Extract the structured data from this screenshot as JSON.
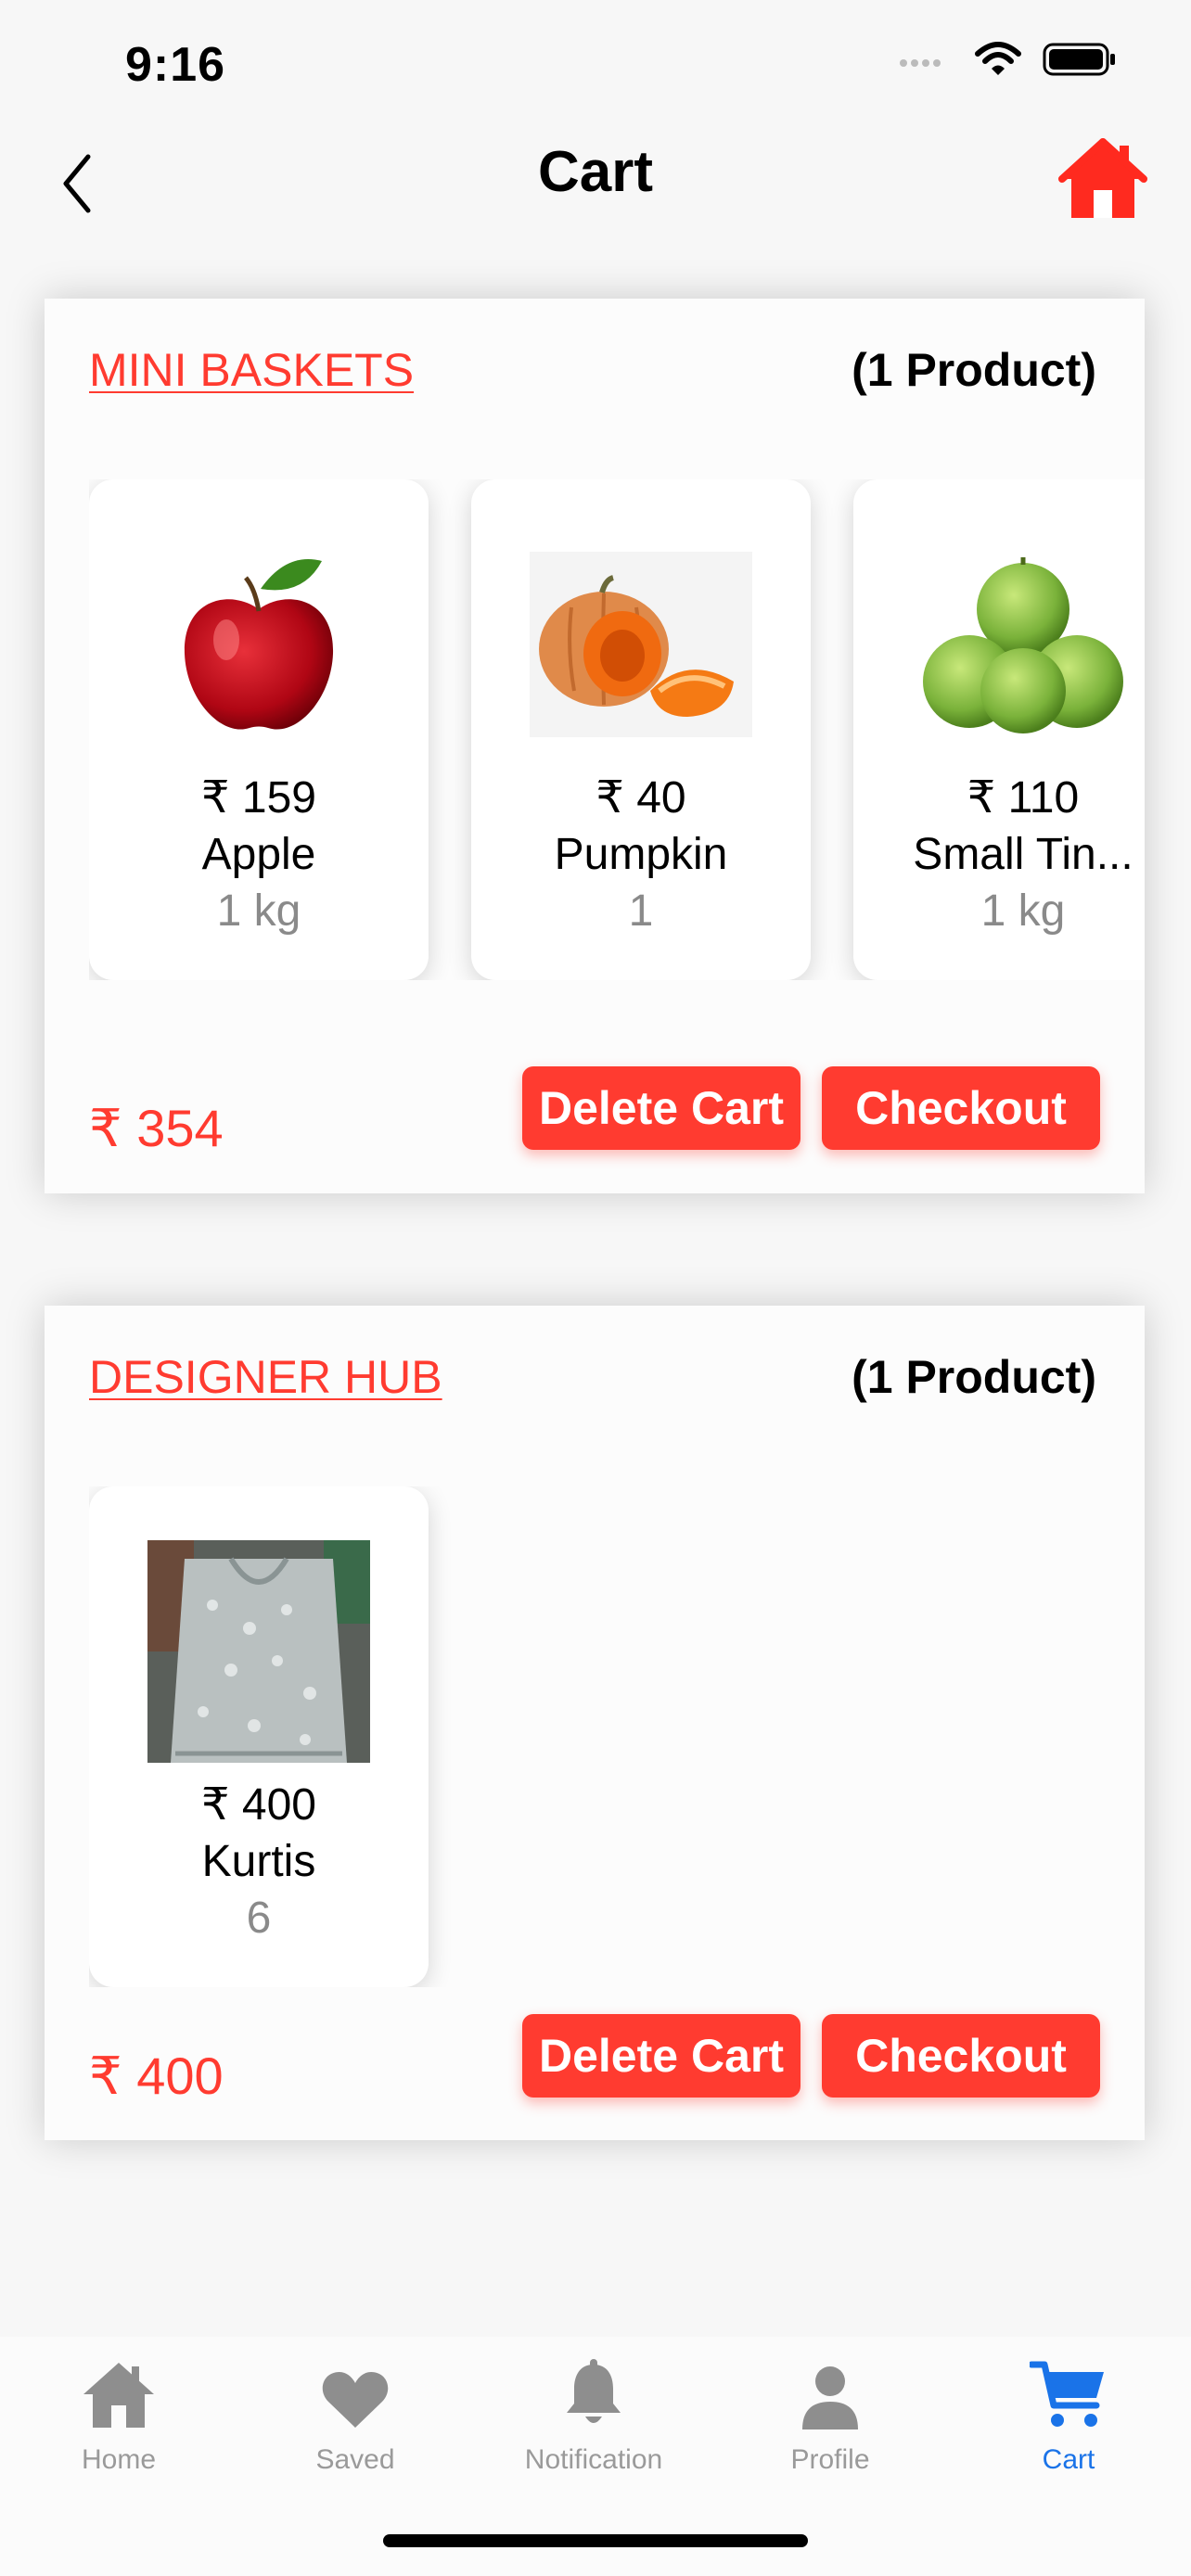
{
  "status_bar": {
    "time": "9:16"
  },
  "nav": {
    "title": "Cart"
  },
  "colors": {
    "accent": "#ff3b30",
    "active_tab": "#1a73e8",
    "inactive_tab": "#9a9a9a"
  },
  "stores": [
    {
      "name": "MINI BASKETS",
      "count": "(1 Product)",
      "products": [
        {
          "price": "₹ 159",
          "name": "Apple",
          "qty": "1 kg",
          "image": "apple-image"
        },
        {
          "price": "₹ 40",
          "name": "Pumpkin",
          "qty": "1",
          "image": "pumpkin-image"
        },
        {
          "price": "₹ 110",
          "name": "Small Tin...",
          "qty": "1 kg",
          "image": "tinda-image"
        }
      ],
      "total": "₹ 354",
      "delete_label": "Delete Cart",
      "checkout_label": "Checkout"
    },
    {
      "name": "DESIGNER HUB",
      "count": "(1 Product)",
      "products": [
        {
          "price": "₹ 400",
          "name": "Kurtis",
          "qty": "6",
          "image": "kurti-image"
        }
      ],
      "total": "₹ 400",
      "delete_label": "Delete Cart",
      "checkout_label": "Checkout"
    }
  ],
  "tabs": [
    {
      "label": "Home",
      "icon": "house-icon"
    },
    {
      "label": "Saved",
      "icon": "heart-icon"
    },
    {
      "label": "Notification",
      "icon": "bell-icon"
    },
    {
      "label": "Profile",
      "icon": "person-icon"
    },
    {
      "label": "Cart",
      "icon": "cart-icon",
      "active": true
    }
  ]
}
